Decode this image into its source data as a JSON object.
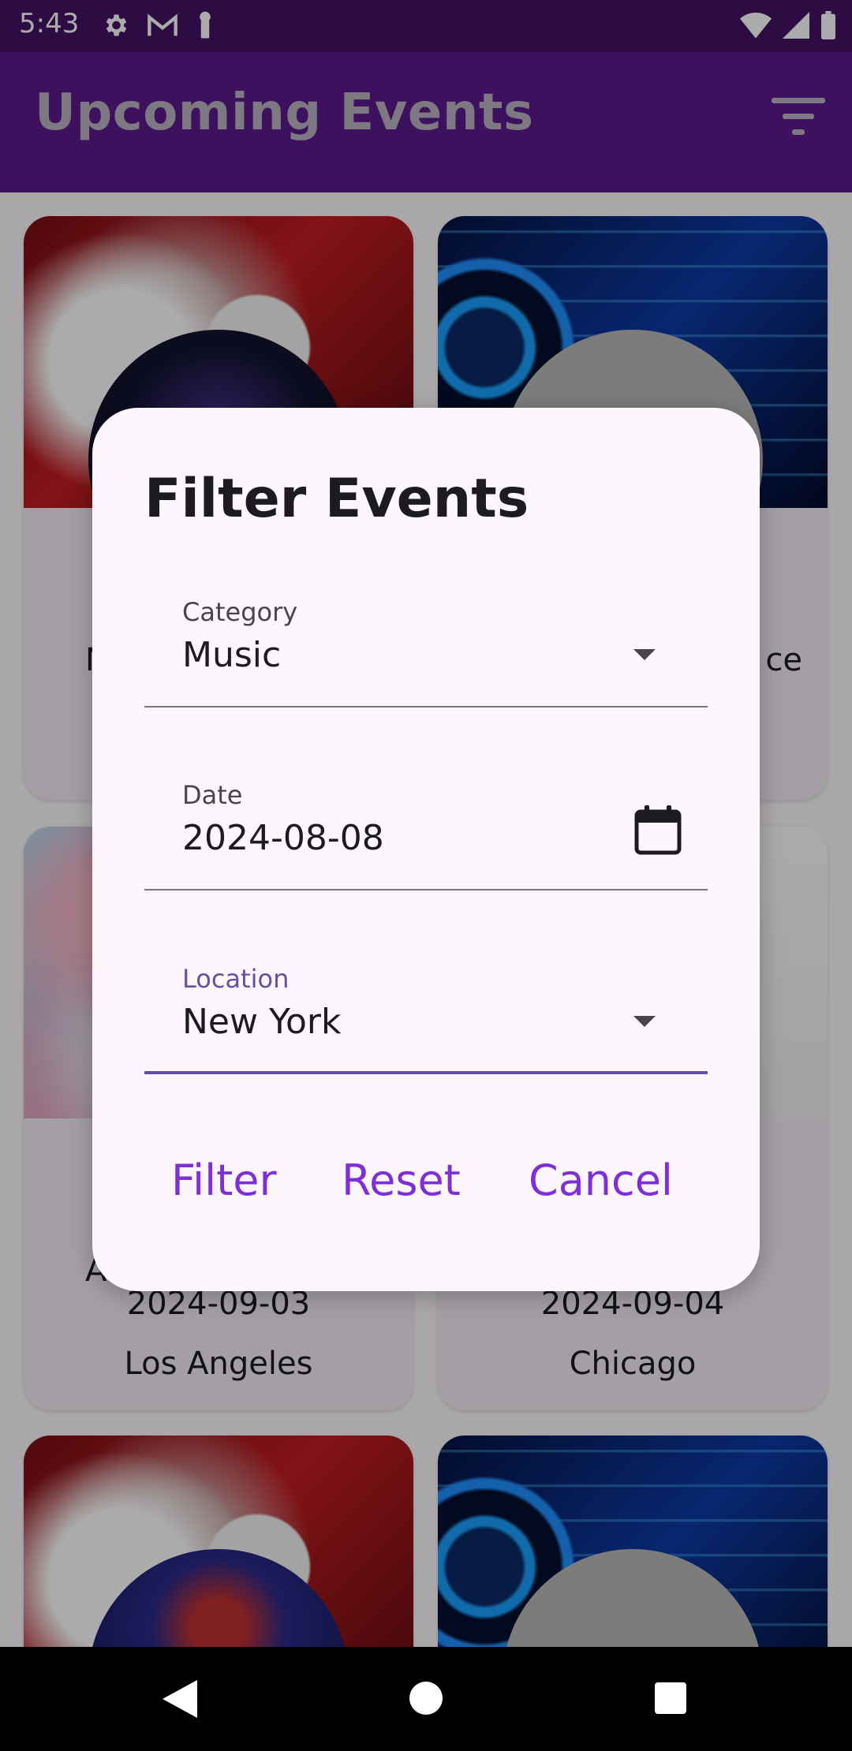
{
  "status_bar": {
    "time": "5:43",
    "left_icons": [
      "settings-icon",
      "gmail-icon",
      "key-icon"
    ],
    "right_icons": [
      "wifi-icon",
      "signal-icon",
      "battery-icon"
    ]
  },
  "app_bar": {
    "title": "Upcoming Events",
    "action_icon": "filter-list-icon"
  },
  "cards": [
    {
      "image": "music-cd-image",
      "title_fragment": "N",
      "date": "",
      "location": ""
    },
    {
      "image": "tech-circuit-image",
      "title_fragment": "ce",
      "date": "",
      "location": ""
    },
    {
      "image": "abstract-paint-image",
      "title_fragment": "A",
      "date": "2024-09-03",
      "location": "Los Angeles"
    },
    {
      "image": "sports-image",
      "title_fragment": "",
      "date": "2024-09-04",
      "location": "Chicago"
    },
    {
      "image": "music-cd-image",
      "title_fragment": "",
      "date": "",
      "location": ""
    },
    {
      "image": "tech-circuit-image",
      "title_fragment": "",
      "date": "",
      "location": ""
    }
  ],
  "dialog": {
    "title": "Filter Events",
    "fields": {
      "category": {
        "label": "Category",
        "value": "Music",
        "trailing_icon": "dropdown-arrow-icon"
      },
      "date": {
        "label": "Date",
        "value": "2024-08-08",
        "trailing_icon": "calendar-icon"
      },
      "location": {
        "label": "Location",
        "value": "New York",
        "trailing_icon": "dropdown-arrow-icon"
      }
    },
    "actions": {
      "filter": "Filter",
      "reset": "Reset",
      "cancel": "Cancel"
    }
  },
  "colors": {
    "status_bar": "#421364",
    "app_bar": "#5b1a8c",
    "accent": "#6750a4",
    "action_text": "#7e2fd6",
    "dialog_bg": "#fdf6fc"
  },
  "nav_bar": {
    "icons": [
      "back-icon",
      "home-icon",
      "recents-icon"
    ]
  }
}
